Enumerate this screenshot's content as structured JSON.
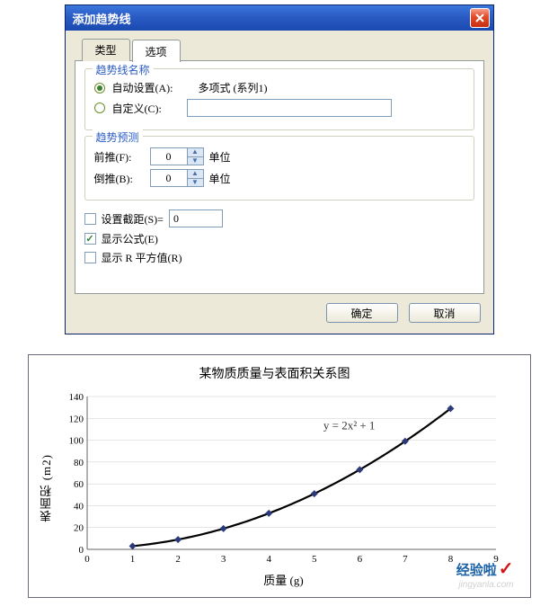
{
  "dialog": {
    "title": "添加趋势线",
    "tabs": {
      "type": "类型",
      "options": "选项"
    },
    "name_group": {
      "legend": "趋势线名称",
      "auto_label": "自动设置(A):",
      "auto_desc": "多项式 (系列1)",
      "custom_label": "自定义(C):",
      "custom_value": ""
    },
    "forecast_group": {
      "legend": "趋势预测",
      "forward_label": "前推(F):",
      "forward_value": "0",
      "backward_label": "倒推(B):",
      "backward_value": "0",
      "unit": "单位"
    },
    "checks": {
      "intercept_label": "设置截距(S)=",
      "intercept_value": "0",
      "show_eq_label": "显示公式(E)",
      "show_r2_label": "显示 R 平方值(R)"
    },
    "buttons": {
      "ok": "确定",
      "cancel": "取消"
    }
  },
  "chart_data": {
    "type": "line",
    "title": "某物质质量与表面积关系图",
    "xlabel": "质量 (g)",
    "ylabel": "表面积 (m2)",
    "equation": "y = 2x² + 1",
    "x": [
      1,
      2,
      3,
      4,
      5,
      6,
      7,
      8
    ],
    "y": [
      3,
      9,
      19,
      33,
      51,
      73,
      99,
      129
    ],
    "xlim": [
      0,
      9
    ],
    "ylim": [
      0,
      140
    ],
    "xticks": [
      0,
      1,
      2,
      3,
      4,
      5,
      6,
      7,
      8,
      9
    ],
    "yticks": [
      0,
      20,
      40,
      60,
      80,
      100,
      120,
      140
    ]
  },
  "watermark": {
    "brand": "经验啦",
    "url": "jingyanla.com"
  }
}
